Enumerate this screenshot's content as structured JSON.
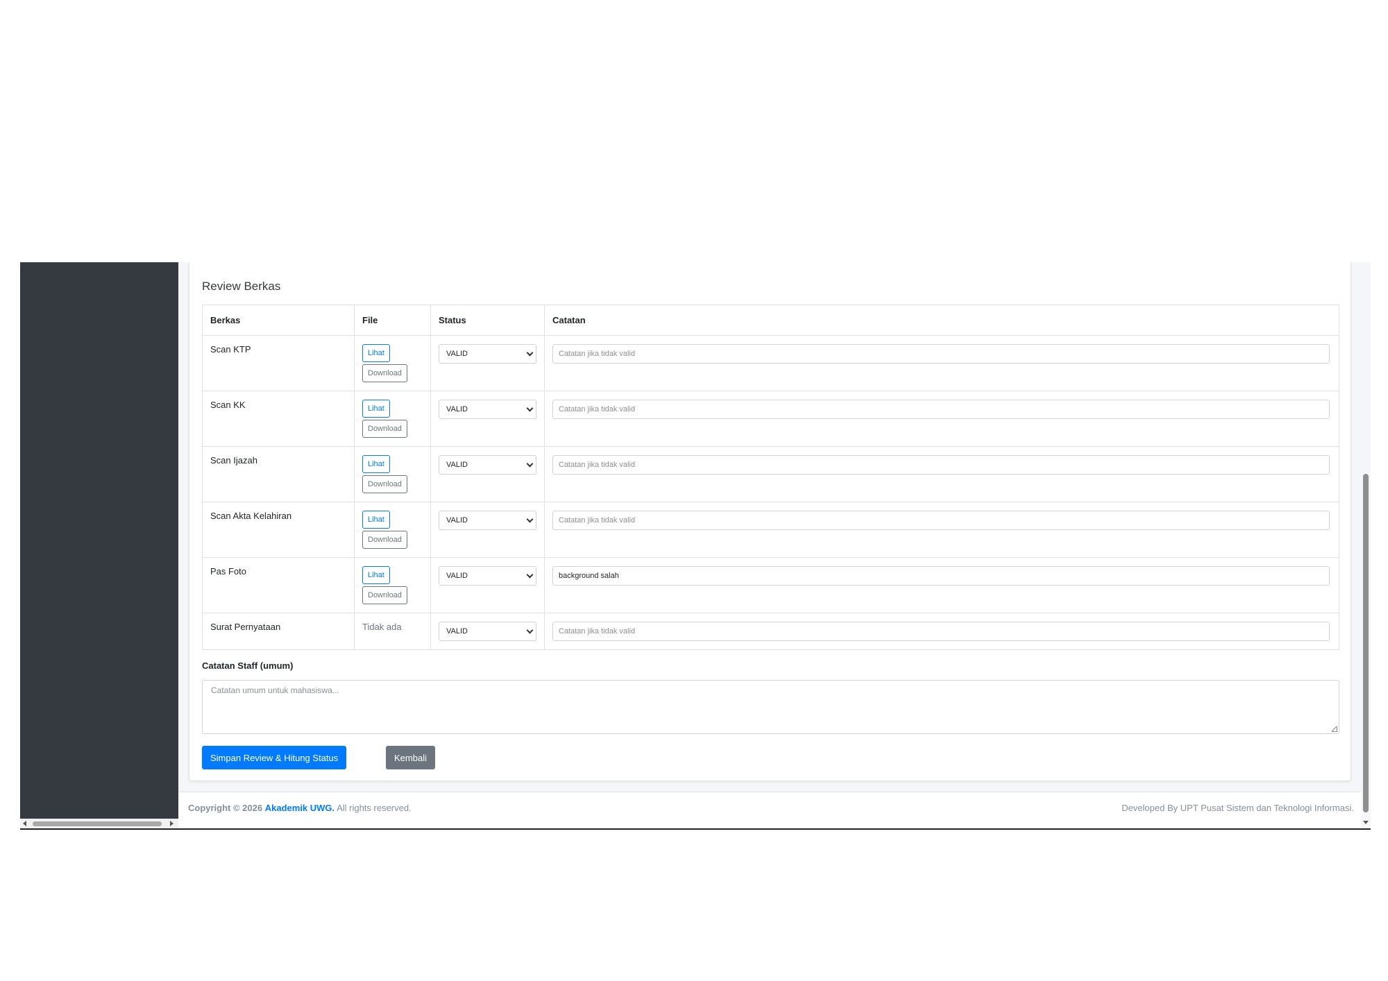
{
  "card": {
    "title": "Review Berkas"
  },
  "table": {
    "headers": {
      "berkas": "Berkas",
      "file": "File",
      "status": "Status",
      "catatan": "Catatan"
    },
    "rows": [
      {
        "name": "Scan KTP",
        "view_label": "Lihat",
        "download_label": "Download",
        "status": "VALID",
        "note_value": "",
        "note_placeholder": "Catatan jika tidak valid"
      },
      {
        "name": "Scan KK",
        "view_label": "Lihat",
        "download_label": "Download",
        "status": "VALID",
        "note_value": "",
        "note_placeholder": "Catatan jika tidak valid"
      },
      {
        "name": "Scan Ijazah",
        "view_label": "Lihat",
        "download_label": "Download",
        "status": "VALID",
        "note_value": "",
        "note_placeholder": "Catatan jika tidak valid"
      },
      {
        "name": "Scan Akta Kelahiran",
        "view_label": "Lihat",
        "download_label": "Download",
        "status": "VALID",
        "note_value": "",
        "note_placeholder": "Catatan jika tidak valid"
      },
      {
        "name": "Pas Foto",
        "view_label": "Lihat",
        "download_label": "Download",
        "status": "VALID",
        "note_value": "background salah",
        "note_placeholder": "Catatan jika tidak valid"
      },
      {
        "name": "Surat Pernyataan",
        "file_text": "Tidak ada",
        "status": "VALID",
        "note_value": "",
        "note_placeholder": "Catatan jika tidak valid"
      }
    ]
  },
  "general_notes": {
    "label": "Catatan Staff (umum)",
    "placeholder": "Catatan umum untuk mahasiswa..."
  },
  "actions": {
    "save_label": "Simpan Review & Hitung Status",
    "back_label": "Kembali"
  },
  "footer": {
    "copyright_prefix": "Copyright © 2026",
    "brand": "Akademik UWG.",
    "rights": "All rights reserved.",
    "developer": "Developed By UPT Pusat Sistem dan Teknologi Informasi."
  },
  "colors": {
    "primary": "#007bff",
    "secondary": "#6c757d",
    "sidebar": "#343a40"
  }
}
